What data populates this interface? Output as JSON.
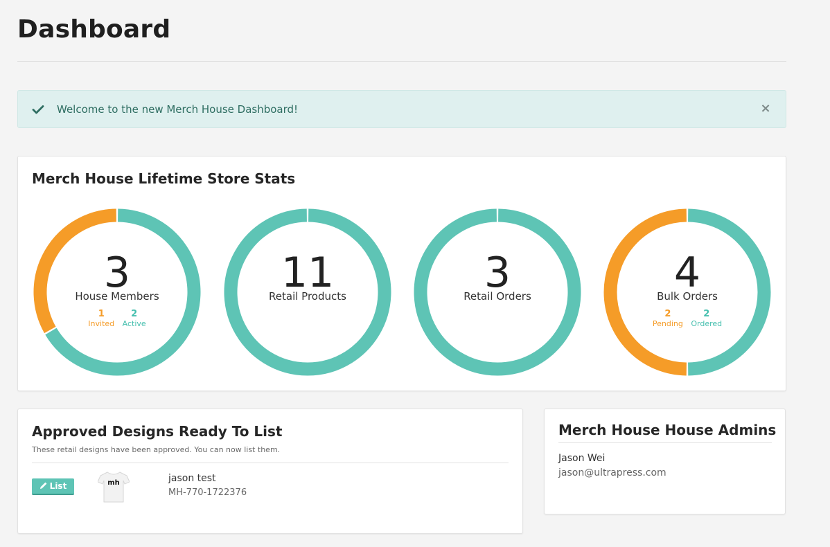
{
  "page": {
    "title": "Dashboard"
  },
  "alert": {
    "message": "Welcome to the new Merch House Dashboard!",
    "close_symbol": "×",
    "icon": "check-icon"
  },
  "stats": {
    "title": "Merch House Lifetime Store Stats",
    "colors": {
      "primary": "#5ec4b5",
      "secondary": "#f59c28"
    },
    "items": [
      {
        "value": "3",
        "label": "House Members",
        "segments": [
          {
            "name": "Invited",
            "value": 1,
            "color": "#f59c28"
          },
          {
            "name": "Active",
            "value": 2,
            "color": "#5ec4b5"
          }
        ],
        "breakdown": [
          {
            "value": "1",
            "label": "Invited"
          },
          {
            "value": "2",
            "label": "Active"
          }
        ]
      },
      {
        "value": "11",
        "label": "Retail Products",
        "segments": [
          {
            "name": "Retail Products",
            "value": 11,
            "color": "#5ec4b5"
          }
        ]
      },
      {
        "value": "3",
        "label": "Retail Orders",
        "segments": [
          {
            "name": "Retail Orders",
            "value": 3,
            "color": "#5ec4b5"
          }
        ]
      },
      {
        "value": "4",
        "label": "Bulk Orders",
        "segments": [
          {
            "name": "Pending",
            "value": 2,
            "color": "#f59c28"
          },
          {
            "name": "Ordered",
            "value": 2,
            "color": "#5ec4b5"
          }
        ],
        "breakdown": [
          {
            "value": "2",
            "label": "Pending"
          },
          {
            "value": "2",
            "label": "Ordered"
          }
        ]
      }
    ]
  },
  "designs": {
    "title": "Approved Designs Ready To List",
    "description": "These retail designs have been approved. You can now list them.",
    "items": [
      {
        "button_label": "List",
        "name": "jason test",
        "code": "MH-770-1722376",
        "shirt_text": "mh"
      }
    ]
  },
  "admins": {
    "title": "Merch House House Admins",
    "items": [
      {
        "name": "Jason Wei",
        "email": "jason@ultrapress.com"
      }
    ]
  }
}
